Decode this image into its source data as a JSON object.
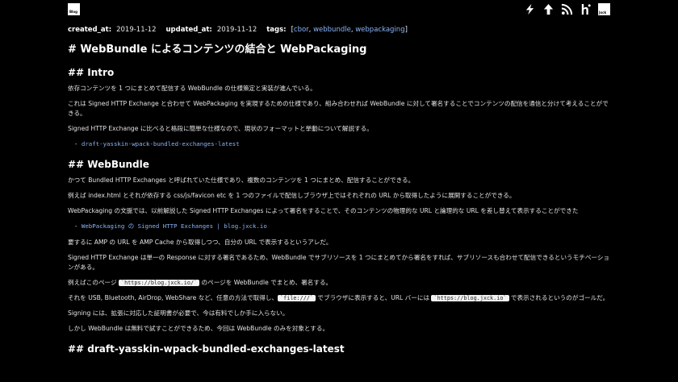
{
  "header": {
    "logo_label": "Blog",
    "jxck_label": "Jxck",
    "icons": [
      "lightning-icon",
      "arrow-up-icon",
      "rss-icon",
      "hatena-icon",
      "jxck-logo"
    ]
  },
  "meta": {
    "created_label": "created_at:",
    "created_value": "2019-11-12",
    "updated_label": "updated_at:",
    "updated_value": "2019-11-12",
    "tags_label": "tags:",
    "tag_open": "[",
    "tags": [
      "cbor",
      "webbundle",
      "webpackaging"
    ],
    "tag_sep": ", ",
    "tag_close": "]"
  },
  "article": {
    "title": "# WebBundle によるコンテンツの結合と WebPackaging",
    "intro_heading": "## Intro",
    "intro_p1": "依存コンテンツを 1 つにまとめて配信する WebBundle の仕様策定と実装が進んでいる。",
    "intro_p2": "これは Signed HTTP Exchange と合わせて WebPackaging を実現するための仕様であり、組み合わせれば WebBundle に対して署名することでコンテンツの配信を通信と分けて考えることができる。",
    "intro_p3": "Signed HTTP Exchange に比べると格段に簡単な仕様なので、現状のフォーマットと挙動について解説する。",
    "intro_list_item": "draft-yasskin-wpack-bundled-exchanges-latest",
    "wb_heading": "## WebBundle",
    "wb_p1": "かつて Bundled HTTP Exchanges と呼ばれていた仕様であり、複数のコンテンツを 1 つにまとめ、配信することができる。",
    "wb_p2": "例えば index.html とそれが依存する css/js/favicon etc を 1 つのファイルで配信しブラウザ上ではそれぞれの URL から取得したように展開することができる。",
    "wb_p3": "WebPackaging の文脈では、以前解説した Signed HTTP Exchanges によって署名をすることで、そのコンテンツの物理的な URL と論理的な URL を差し替えて表示することができた",
    "wb_list_item": "WebPackaging の Signed HTTP Exchanges | blog.jxck.io",
    "wb_p4": "要するに AMP の URL を AMP Cache から取得しつつ、自分の URL で表示するというアレだ。",
    "wb_p5": "Signed HTTP Exchange は単一の Response に対する署名であるため、WebBundle でサブリソースを 1 つにまとめてから署名をすれば、サブリソースも合わせて配信できるというモチベーションがある。",
    "wb_p6_pre": "例えばこのページ ",
    "wb_p6_code": "`https://blog.jxck.io/`",
    "wb_p6_post": " のページを WebBundle でまとめ、署名する。",
    "wb_p7_pre": "それを USB, Bluetooth, AirDrop, WebShare など、任意の方法で取得し、",
    "wb_p7_code1": "`file:///`",
    "wb_p7_mid": " でブラウザに表示すると、URL バーには ",
    "wb_p7_code2": "`https://blog.jxck.io`",
    "wb_p7_post": " で表示されるというのがゴールだ。",
    "wb_p8": "Signing には、拡張に対応した証明書が必要で、今は有料でしか手に入らない。",
    "wb_p9": "しかし WebBundle は無料で試すことができるため、今回は WebBundle のみを対象とする。",
    "draft_heading": "## draft-yasskin-wpack-bundled-exchanges-latest"
  },
  "colors": {
    "background": "#000000",
    "link": "#8ab4f8",
    "text": "#e4e4e4"
  }
}
